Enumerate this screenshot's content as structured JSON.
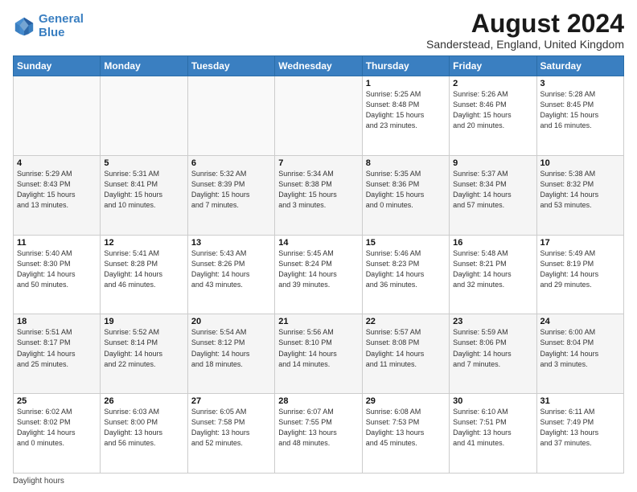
{
  "logo": {
    "line1": "General",
    "line2": "Blue"
  },
  "title": "August 2024",
  "subtitle": "Sanderstead, England, United Kingdom",
  "footer": "Daylight hours",
  "headers": [
    "Sunday",
    "Monday",
    "Tuesday",
    "Wednesday",
    "Thursday",
    "Friday",
    "Saturday"
  ],
  "weeks": [
    [
      {
        "day": "",
        "info": ""
      },
      {
        "day": "",
        "info": ""
      },
      {
        "day": "",
        "info": ""
      },
      {
        "day": "",
        "info": ""
      },
      {
        "day": "1",
        "info": "Sunrise: 5:25 AM\nSunset: 8:48 PM\nDaylight: 15 hours\nand 23 minutes."
      },
      {
        "day": "2",
        "info": "Sunrise: 5:26 AM\nSunset: 8:46 PM\nDaylight: 15 hours\nand 20 minutes."
      },
      {
        "day": "3",
        "info": "Sunrise: 5:28 AM\nSunset: 8:45 PM\nDaylight: 15 hours\nand 16 minutes."
      }
    ],
    [
      {
        "day": "4",
        "info": "Sunrise: 5:29 AM\nSunset: 8:43 PM\nDaylight: 15 hours\nand 13 minutes."
      },
      {
        "day": "5",
        "info": "Sunrise: 5:31 AM\nSunset: 8:41 PM\nDaylight: 15 hours\nand 10 minutes."
      },
      {
        "day": "6",
        "info": "Sunrise: 5:32 AM\nSunset: 8:39 PM\nDaylight: 15 hours\nand 7 minutes."
      },
      {
        "day": "7",
        "info": "Sunrise: 5:34 AM\nSunset: 8:38 PM\nDaylight: 15 hours\nand 3 minutes."
      },
      {
        "day": "8",
        "info": "Sunrise: 5:35 AM\nSunset: 8:36 PM\nDaylight: 15 hours\nand 0 minutes."
      },
      {
        "day": "9",
        "info": "Sunrise: 5:37 AM\nSunset: 8:34 PM\nDaylight: 14 hours\nand 57 minutes."
      },
      {
        "day": "10",
        "info": "Sunrise: 5:38 AM\nSunset: 8:32 PM\nDaylight: 14 hours\nand 53 minutes."
      }
    ],
    [
      {
        "day": "11",
        "info": "Sunrise: 5:40 AM\nSunset: 8:30 PM\nDaylight: 14 hours\nand 50 minutes."
      },
      {
        "day": "12",
        "info": "Sunrise: 5:41 AM\nSunset: 8:28 PM\nDaylight: 14 hours\nand 46 minutes."
      },
      {
        "day": "13",
        "info": "Sunrise: 5:43 AM\nSunset: 8:26 PM\nDaylight: 14 hours\nand 43 minutes."
      },
      {
        "day": "14",
        "info": "Sunrise: 5:45 AM\nSunset: 8:24 PM\nDaylight: 14 hours\nand 39 minutes."
      },
      {
        "day": "15",
        "info": "Sunrise: 5:46 AM\nSunset: 8:23 PM\nDaylight: 14 hours\nand 36 minutes."
      },
      {
        "day": "16",
        "info": "Sunrise: 5:48 AM\nSunset: 8:21 PM\nDaylight: 14 hours\nand 32 minutes."
      },
      {
        "day": "17",
        "info": "Sunrise: 5:49 AM\nSunset: 8:19 PM\nDaylight: 14 hours\nand 29 minutes."
      }
    ],
    [
      {
        "day": "18",
        "info": "Sunrise: 5:51 AM\nSunset: 8:17 PM\nDaylight: 14 hours\nand 25 minutes."
      },
      {
        "day": "19",
        "info": "Sunrise: 5:52 AM\nSunset: 8:14 PM\nDaylight: 14 hours\nand 22 minutes."
      },
      {
        "day": "20",
        "info": "Sunrise: 5:54 AM\nSunset: 8:12 PM\nDaylight: 14 hours\nand 18 minutes."
      },
      {
        "day": "21",
        "info": "Sunrise: 5:56 AM\nSunset: 8:10 PM\nDaylight: 14 hours\nand 14 minutes."
      },
      {
        "day": "22",
        "info": "Sunrise: 5:57 AM\nSunset: 8:08 PM\nDaylight: 14 hours\nand 11 minutes."
      },
      {
        "day": "23",
        "info": "Sunrise: 5:59 AM\nSunset: 8:06 PM\nDaylight: 14 hours\nand 7 minutes."
      },
      {
        "day": "24",
        "info": "Sunrise: 6:00 AM\nSunset: 8:04 PM\nDaylight: 14 hours\nand 3 minutes."
      }
    ],
    [
      {
        "day": "25",
        "info": "Sunrise: 6:02 AM\nSunset: 8:02 PM\nDaylight: 14 hours\nand 0 minutes."
      },
      {
        "day": "26",
        "info": "Sunrise: 6:03 AM\nSunset: 8:00 PM\nDaylight: 13 hours\nand 56 minutes."
      },
      {
        "day": "27",
        "info": "Sunrise: 6:05 AM\nSunset: 7:58 PM\nDaylight: 13 hours\nand 52 minutes."
      },
      {
        "day": "28",
        "info": "Sunrise: 6:07 AM\nSunset: 7:55 PM\nDaylight: 13 hours\nand 48 minutes."
      },
      {
        "day": "29",
        "info": "Sunrise: 6:08 AM\nSunset: 7:53 PM\nDaylight: 13 hours\nand 45 minutes."
      },
      {
        "day": "30",
        "info": "Sunrise: 6:10 AM\nSunset: 7:51 PM\nDaylight: 13 hours\nand 41 minutes."
      },
      {
        "day": "31",
        "info": "Sunrise: 6:11 AM\nSunset: 7:49 PM\nDaylight: 13 hours\nand 37 minutes."
      }
    ]
  ]
}
